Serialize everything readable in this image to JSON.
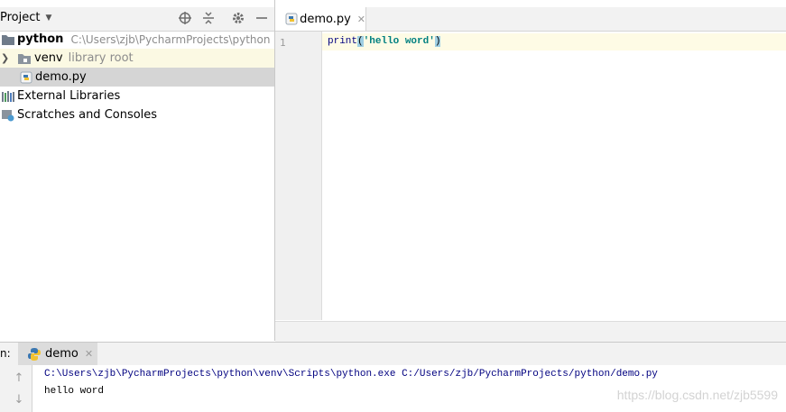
{
  "project_panel": {
    "title": "Project",
    "tree": {
      "root": {
        "name": "python",
        "path": "C:\\Users\\zjb\\PycharmProjects\\python"
      },
      "venv": {
        "name": "venv",
        "note": "library root"
      },
      "file": {
        "name": "demo.py"
      },
      "external": {
        "name": "External Libraries"
      },
      "scratches": {
        "name": "Scratches and Consoles"
      }
    }
  },
  "editor": {
    "tab_label": "demo.py",
    "line_number": "1",
    "code": {
      "fn": "print",
      "open": "(",
      "string": "'hello word'",
      "close": ")"
    }
  },
  "run_panel": {
    "label": "n:",
    "tab_label": "demo",
    "command": "C:\\Users\\zjb\\PycharmProjects\\python\\venv\\Scripts\\python.exe C:/Users/zjb/PycharmProjects/python/demo.py",
    "output": "hello word"
  },
  "watermark": "https://blog.csdn.net/zjb5599",
  "colors": {
    "selection": "#d5d5d5",
    "venv_row": "#fbf9e3",
    "current_line": "#fefbe5",
    "keyword": "#000080",
    "string": "#008080",
    "paren_match": "#9fcfe3"
  },
  "icons": [
    "locate-icon",
    "collapse-icon",
    "gear-icon",
    "minimize-icon",
    "folder-icon",
    "python-file-icon",
    "libraries-icon",
    "scratches-icon",
    "rerun-up-icon",
    "rerun-down-icon"
  ]
}
